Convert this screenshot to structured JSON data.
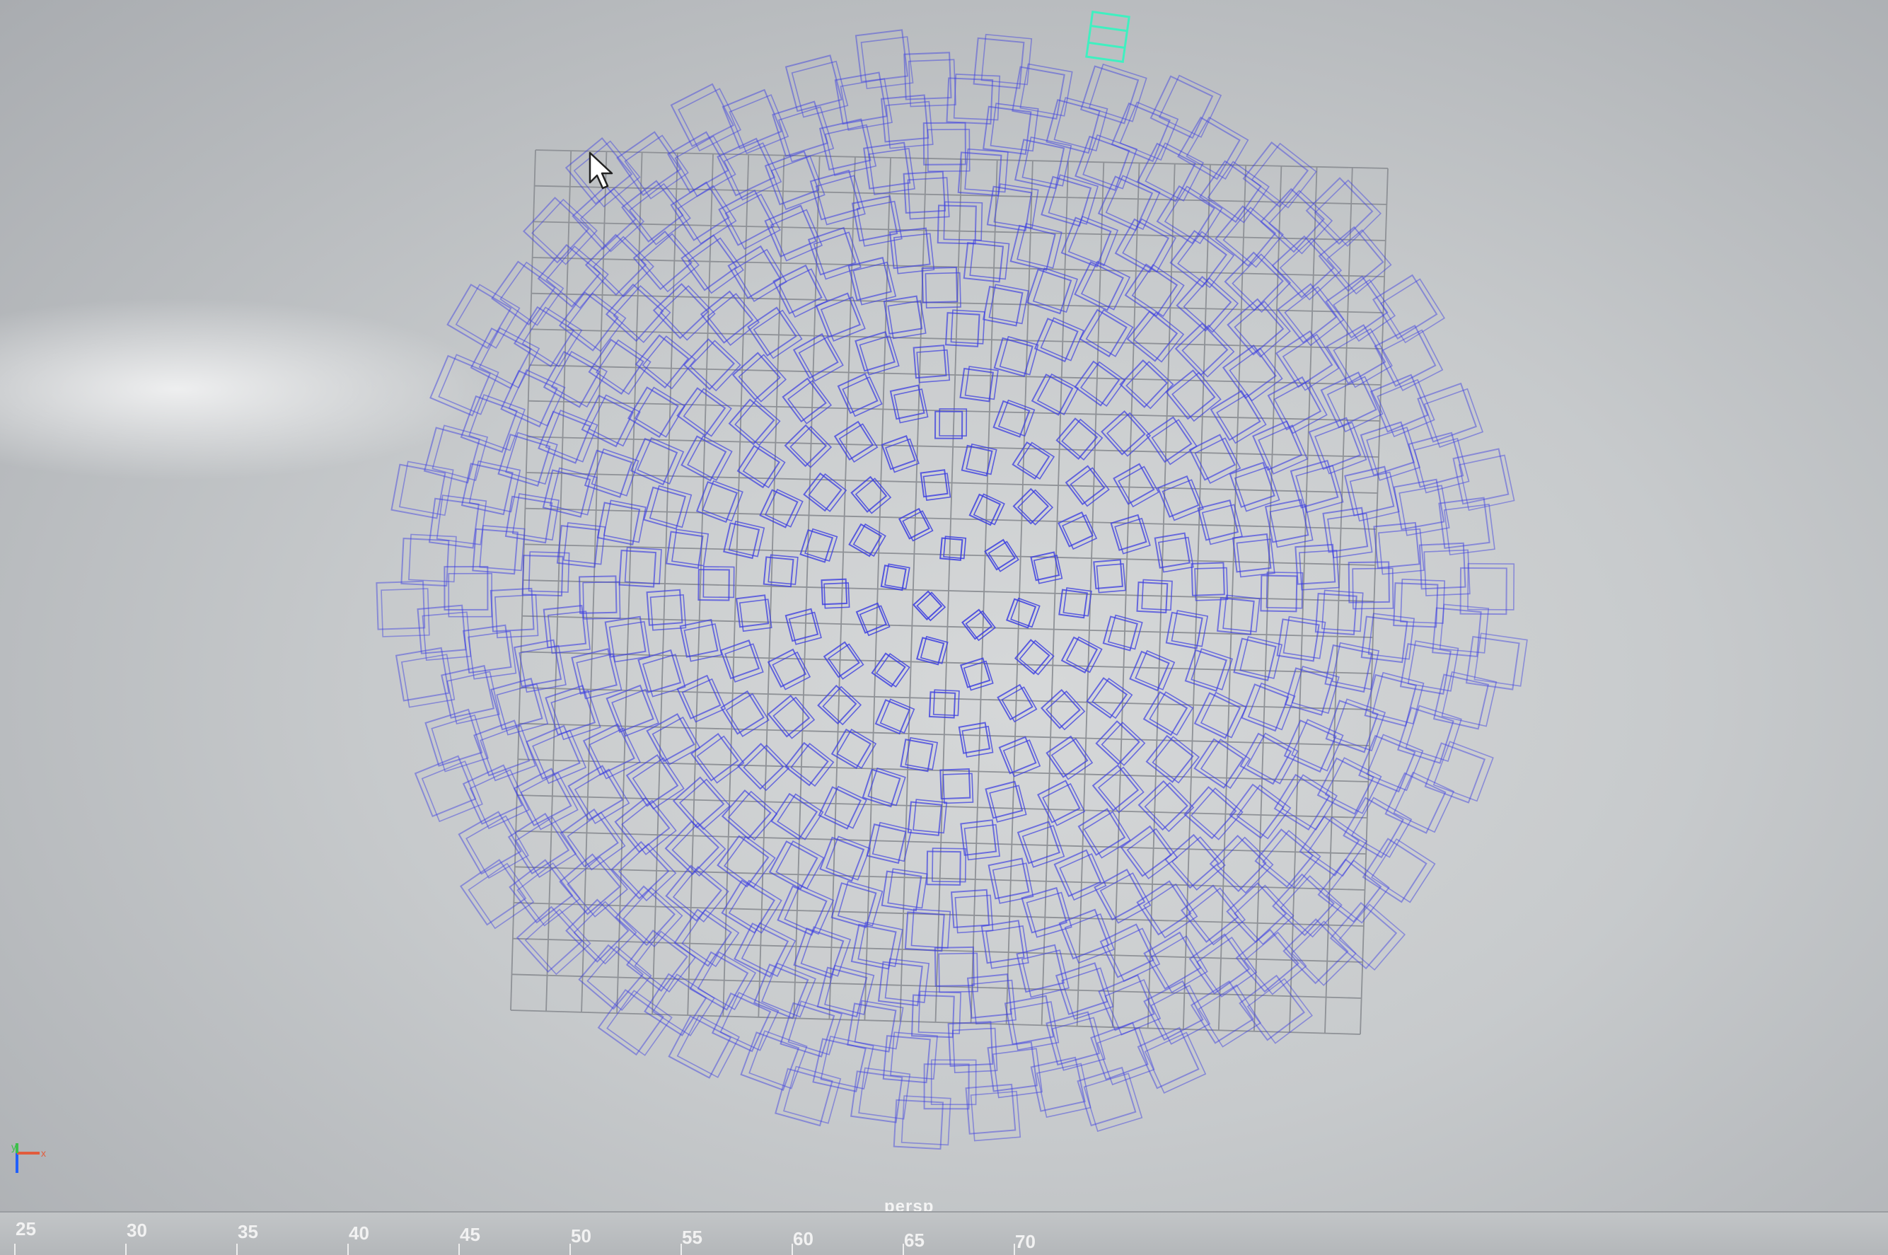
{
  "viewport": {
    "camera_name": "persp"
  },
  "timeline": {
    "ticks": [
      "25",
      "30",
      "35",
      "40",
      "45",
      "50",
      "55",
      "60",
      "65",
      "70"
    ]
  },
  "axis_gizmo": {
    "labels": [
      "y",
      "x",
      "z"
    ]
  },
  "colors": {
    "grid": "#8e9196",
    "wireframe": "#3c3ee0",
    "selected_wireframe": "#3ff0c0",
    "timeline_text": "#f2f2f2"
  },
  "icons": {
    "cursor": "arrow-cursor-icon",
    "gizmo": "axis-gizmo-icon"
  },
  "scene": {
    "grid_divisions": 24,
    "object_count": 400,
    "object_type": "cube",
    "arrangement": "phyllotaxis spiral",
    "selected_objects": 1
  }
}
